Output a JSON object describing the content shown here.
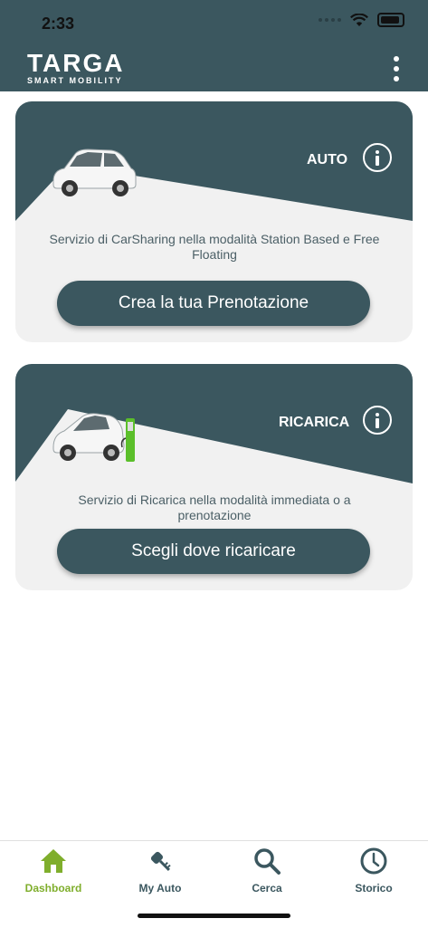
{
  "status": {
    "time": "2:33"
  },
  "header": {
    "logo_main": "TARGA",
    "logo_sub": "SMART MOBILITY"
  },
  "cards": [
    {
      "title": "AUTO",
      "description": "Servizio di CarSharing nella modalità Station Based e Free Floating",
      "button": "Crea la tua Prenotazione",
      "icon": "car-icon"
    },
    {
      "title": "RICARICA",
      "description": "Servizio di Ricarica nella modalità immediata o a prenotazione",
      "button": "Scegli dove ricaricare",
      "icon": "ev-charging-icon"
    }
  ],
  "tabs": [
    {
      "label": "Dashboard",
      "icon": "home-icon",
      "active": true
    },
    {
      "label": "My Auto",
      "icon": "key-icon",
      "active": false
    },
    {
      "label": "Cerca",
      "icon": "search-icon",
      "active": false
    },
    {
      "label": "Storico",
      "icon": "clock-icon",
      "active": false
    }
  ],
  "colors": {
    "primary": "#3b575f",
    "card_bg": "#f1f1f1",
    "active_tab": "#7fae2c",
    "muted_text": "#4b5f66"
  }
}
